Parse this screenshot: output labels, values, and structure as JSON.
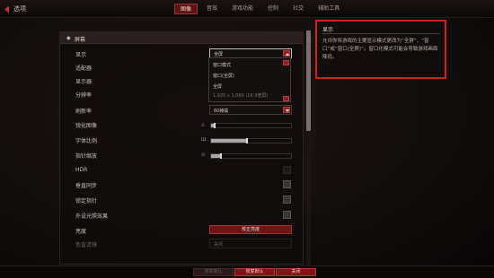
{
  "header": {
    "back_label": "选项",
    "tabs": [
      {
        "label": "图像",
        "active": true
      },
      {
        "label": "音效",
        "active": false
      },
      {
        "label": "游戏功能",
        "active": false
      },
      {
        "label": "控制",
        "active": false
      },
      {
        "label": "社交",
        "active": false
      },
      {
        "label": "辅助工具",
        "active": false
      }
    ]
  },
  "panel": {
    "section_title": "屏幕",
    "rows": {
      "display": {
        "label": "显示",
        "value": "全屏"
      },
      "adapter": {
        "label": "适配器"
      },
      "monitor": {
        "label": "显示器"
      },
      "resolution": {
        "label": "分辨率"
      },
      "refresh": {
        "label": "刷新率",
        "value": "60赫兹"
      },
      "sharpen": {
        "label": "锐化图像",
        "level": 0.05
      },
      "font_scale": {
        "label": "字体比例",
        "level": 0.45
      },
      "cursor_scale": {
        "label": "指针缩放",
        "level": 0.12
      },
      "hdr": {
        "label": "HDR"
      },
      "vsync": {
        "label": "垂直同步"
      },
      "lock_cursor": {
        "label": "锁定指针"
      },
      "peripheral": {
        "label": "外设光照效果"
      },
      "brightness": {
        "label": "亮度",
        "button": "校正亮度"
      },
      "colorblind": {
        "label": "色盲滤镜",
        "value": "关闭"
      }
    },
    "dropdown_options": [
      "窗口模式",
      "窗口(全屏)",
      "全屏",
      "1,920 x 1,080 (16:9宽屏)"
    ]
  },
  "description": {
    "title": "显示",
    "body": "允许你将游戏的主要显示模式更改为“全屏”、“窗口”或“窗口(全屏)”。窗口化模式可能会导致游戏画面降低。"
  },
  "footer": {
    "default_label": "恢复默认",
    "apply_label": "恢复默认",
    "close_label": "关闭"
  },
  "colors": {
    "accent": "#8e1e1e",
    "highlight": "#d42020"
  }
}
